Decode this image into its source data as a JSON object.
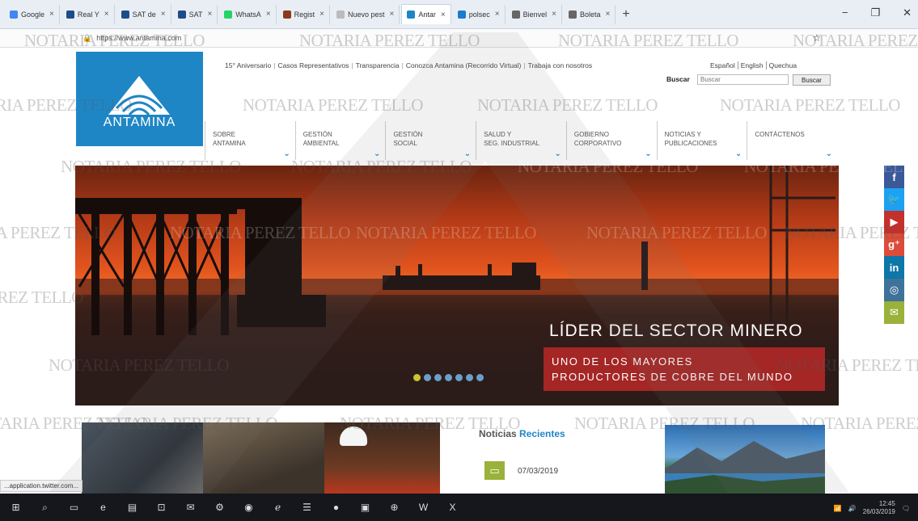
{
  "browser": {
    "tabs": [
      {
        "label": "Google",
        "color": "#4285f4"
      },
      {
        "label": "Real Y",
        "color": "#1c4d8a"
      },
      {
        "label": "SAT de",
        "color": "#1c4d8a"
      },
      {
        "label": "SAT",
        "color": "#1c4d8a"
      },
      {
        "label": "WhatsA",
        "color": "#25d366"
      },
      {
        "label": "Regist",
        "color": "#8a3a1c"
      },
      {
        "label": "Nuevo pest",
        "color": "#bbbbbb"
      },
      {
        "label": "Antar",
        "color": "#1f86c6"
      },
      {
        "label": "polsec",
        "color": "#1c7ad0"
      },
      {
        "label": "Bienvel",
        "color": "#666666"
      },
      {
        "label": "Boleta",
        "color": "#666666"
      }
    ],
    "new_tab": "+",
    "window_controls": {
      "minimize": "−",
      "maximize": "❐",
      "close": "✕"
    },
    "address_url": "https://www.antamina.com"
  },
  "site": {
    "logo_text": "ANTAMINA",
    "top_links": [
      "15° Aniversario",
      "Casos Representativos",
      "Transparencia",
      "Conozca Antamina (Recorrido Virtual)",
      "Trabaja con nosotros"
    ],
    "lang_links": [
      "Español",
      "English",
      "Quechua"
    ],
    "search": {
      "label": "Buscar",
      "placeholder": "Buscar",
      "button": "Buscar"
    },
    "nav": [
      {
        "line1": "SOBRE",
        "line2": "ANTAMINA"
      },
      {
        "line1": "GESTIÓN",
        "line2": "AMBIENTAL"
      },
      {
        "line1": "GESTIÓN",
        "line2": "SOCIAL"
      },
      {
        "line1": "SALUD Y",
        "line2": "SEG. INDUSTRIAL"
      },
      {
        "line1": "GOBIERNO",
        "line2": "CORPORATIVO"
      },
      {
        "line1": "NOTICIAS Y",
        "line2": "PUBLICACIONES"
      },
      {
        "line1": "CONTÁCTENOS",
        "line2": ""
      }
    ],
    "hero": {
      "title": "LÍDER DEL SECTOR MINERO",
      "subtitle_line1": "UNO DE LOS MAYORES",
      "subtitle_line2": "PRODUCTORES DE COBRE DEL MUNDO",
      "slide_count": 7,
      "active_slide": 1
    },
    "social": [
      {
        "name": "facebook-icon",
        "glyph": "f",
        "color": "#3b5998"
      },
      {
        "name": "twitter-icon",
        "glyph": "🐦",
        "color": "#1da1f2"
      },
      {
        "name": "youtube-icon",
        "glyph": "▶",
        "color": "#c4302b"
      },
      {
        "name": "google-plus-icon",
        "glyph": "g⁺",
        "color": "#dd4b39"
      },
      {
        "name": "linkedin-icon",
        "glyph": "in",
        "color": "#0e76a8"
      },
      {
        "name": "instagram-icon",
        "glyph": "◎",
        "color": "#3f729b"
      },
      {
        "name": "email-icon",
        "glyph": "✉",
        "color": "#9ab13a"
      }
    ],
    "news": {
      "title_part1": "Noticias",
      "title_part2": "Recientes",
      "date": "07/03/2019"
    }
  },
  "status_url": "...application.twitter.com...",
  "watermark": "NOTARIA PEREZ TELLO",
  "taskbar": {
    "icons": [
      "windows-start-icon",
      "search-icon",
      "task-view-icon",
      "edge-icon",
      "file-explorer-icon",
      "store-icon",
      "mail-icon",
      "settings-icon",
      "firefox-icon",
      "ie-icon",
      "app-icon",
      "chrome-icon",
      "pdf-icon",
      "network-icon",
      "word-icon",
      "excel-icon"
    ],
    "clock_time": "12:45",
    "clock_date": "26/03/2019"
  }
}
